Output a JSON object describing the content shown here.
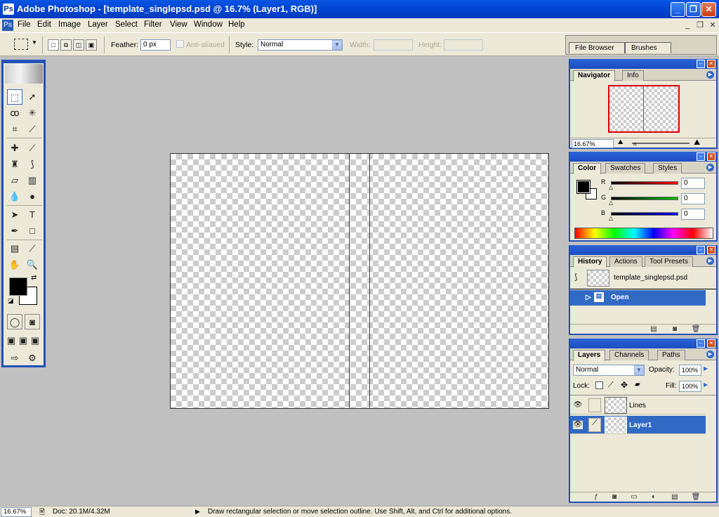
{
  "window": {
    "title": "Adobe Photoshop - [template_singlepsd.psd @ 16.7% (Layer1, RGB)]",
    "controls": [
      "minimize",
      "maximize",
      "close"
    ]
  },
  "menubar": {
    "items": [
      "File",
      "Edit",
      "Image",
      "Layer",
      "Select",
      "Filter",
      "View",
      "Window",
      "Help"
    ]
  },
  "options": {
    "feather_label": "Feather:",
    "feather_value": "0 px",
    "antialiased_label": "Anti-aliased",
    "style_label": "Style:",
    "style_value": "Normal",
    "width_label": "Width:",
    "height_label": "Height:"
  },
  "palette_well": {
    "tabs": [
      "File Browser",
      "Brushes"
    ]
  },
  "navigator": {
    "tabs": [
      "Navigator",
      "Info"
    ],
    "zoom": "16.67%"
  },
  "color_panel": {
    "tabs": [
      "Color",
      "Swatches",
      "Styles"
    ],
    "channels": [
      {
        "label": "R",
        "value": "0",
        "color": "#ff0000"
      },
      {
        "label": "G",
        "value": "0",
        "color": "#00c000"
      },
      {
        "label": "B",
        "value": "0",
        "color": "#0000ff"
      }
    ]
  },
  "history": {
    "tabs": [
      "History",
      "Actions",
      "Tool Presets"
    ],
    "snapshot": "template_singlepsd.psd",
    "states": [
      "Open"
    ]
  },
  "layers": {
    "tabs": [
      "Layers",
      "Channels",
      "Paths"
    ],
    "blend_mode": "Normal",
    "opacity_label": "Opacity:",
    "opacity_value": "100%",
    "lock_label": "Lock:",
    "fill_label": "Fill:",
    "fill_value": "100%",
    "items": [
      {
        "name": "Lines",
        "selected": false
      },
      {
        "name": "Layer1",
        "selected": true
      }
    ]
  },
  "status": {
    "zoom": "16.67%",
    "doc": "Doc: 20.1M/4.32M",
    "hint": "Draw rectangular selection or move selection outline.  Use Shift, Alt, and Ctrl for additional options."
  },
  "colors": {
    "titlebar": "#0a56e4",
    "chrome": "#ece9d8",
    "selection": "#316ac5",
    "workspace": "#c0c0c0"
  }
}
